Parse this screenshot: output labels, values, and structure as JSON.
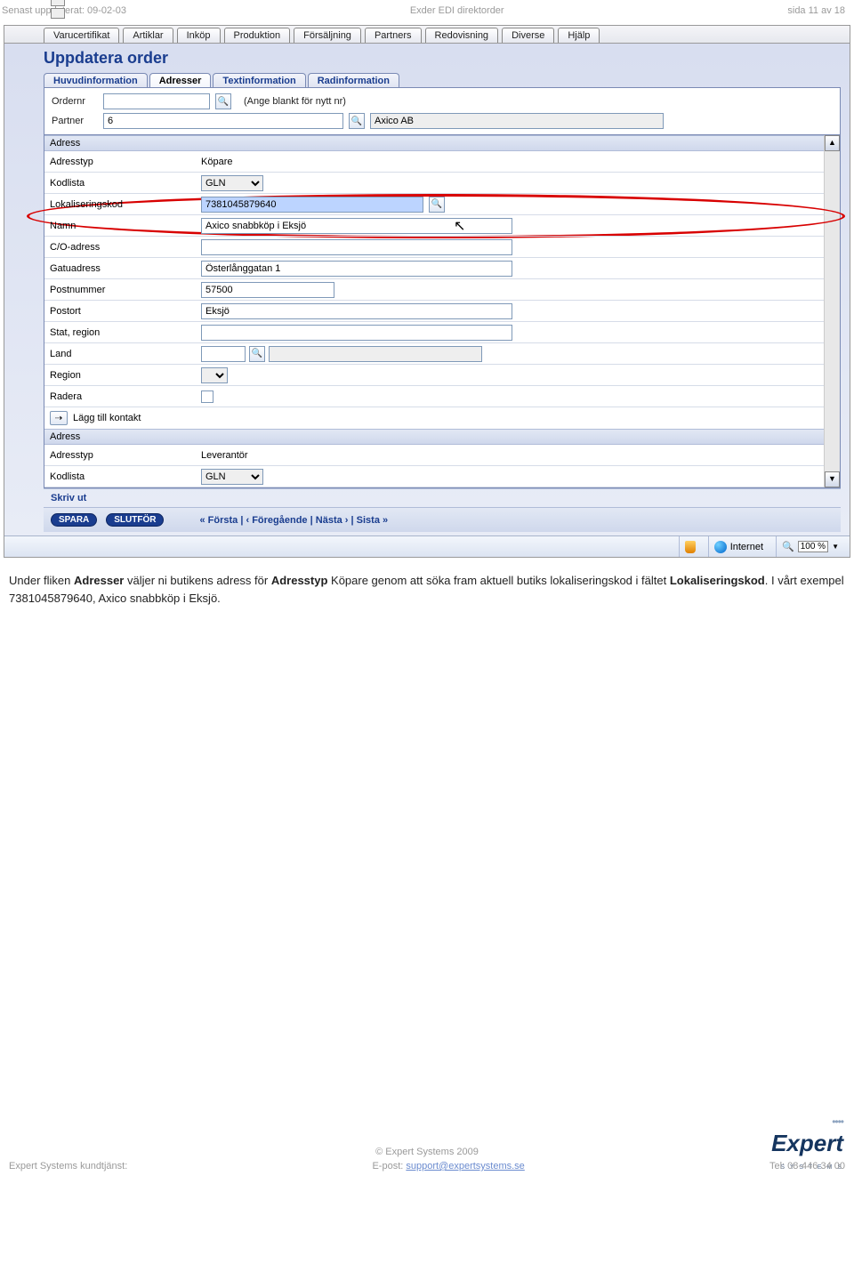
{
  "doc_header": {
    "left": "Senast uppdaterat: 09-02-03",
    "center": "Exder EDI direktorder",
    "right": "sida 11 av 18"
  },
  "menu": [
    "Varucertifikat",
    "Artiklar",
    "Inköp",
    "Produktion",
    "Försäljning",
    "Partners",
    "Redovisning",
    "Diverse",
    "Hjälp"
  ],
  "page_title": "Uppdatera order",
  "subtabs": [
    "Huvudinformation",
    "Adresser",
    "Textinformation",
    "Radinformation"
  ],
  "subtab_active": "Adresser",
  "header_form": {
    "ordernr_label": "Ordernr",
    "ordernr_value": "",
    "ordernr_hint": "(Ange blankt för nytt nr)",
    "partner_label": "Partner",
    "partner_value": "6",
    "partner_name": "Axico AB"
  },
  "section1_title": "Adress",
  "fields1": {
    "adresstyp_label": "Adresstyp",
    "adresstyp_value": "Köpare",
    "kodlista_label": "Kodlista",
    "kodlista_value": "GLN",
    "lokal_label": "Lokaliseringskod",
    "lokal_value": "7381045879640",
    "namn_label": "Namn",
    "namn_value": "Axico snabbköp i Eksjö",
    "co_label": "C/O-adress",
    "co_value": "",
    "gatu_label": "Gatuadress",
    "gatu_value": "Österlånggatan 1",
    "postnr_label": "Postnummer",
    "postnr_value": "57500",
    "postort_label": "Postort",
    "postort_value": "Eksjö",
    "stat_label": "Stat, region",
    "stat_value": "",
    "land_label": "Land",
    "land_value": "",
    "region_label": "Region",
    "radera_label": "Radera"
  },
  "add_contact": "Lägg till kontakt",
  "section2_title": "Adress",
  "fields2": {
    "adresstyp_label": "Adresstyp",
    "adresstyp_value": "Leverantör",
    "kodlista_label": "Kodlista",
    "kodlista_value": "GLN"
  },
  "print": "Skriv ut",
  "save": "SPARA",
  "finish": "SLUTFÖR",
  "nav": {
    "first": "« Första",
    "prev": "‹ Föregående",
    "next": "Nästa ›",
    "last": "Sista »"
  },
  "status": {
    "zone": "Internet",
    "zoom": "100 %"
  },
  "paragraph": {
    "p1a": "Under fliken ",
    "p1b": "Adresser",
    "p1c": " väljer ni butikens adress för ",
    "p1d": "Adresstyp",
    "p1e": " Köpare genom att söka fram aktuell butiks lokaliseringskod i fältet ",
    "p1f": "Lokaliseringskod",
    "p1g": ". I vårt exempel 7381045879640, Axico snabbköp i Eksjö."
  },
  "footer": {
    "copyright": "© Expert Systems 2009",
    "left": "Expert Systems kundtjänst:",
    "mid_label": "E-post: ",
    "mid_link": "support@expertsystems.se",
    "right": "Tel: 08-446 34 00",
    "logo": "Expert",
    "logo_sub": "S Y S T E M S"
  }
}
